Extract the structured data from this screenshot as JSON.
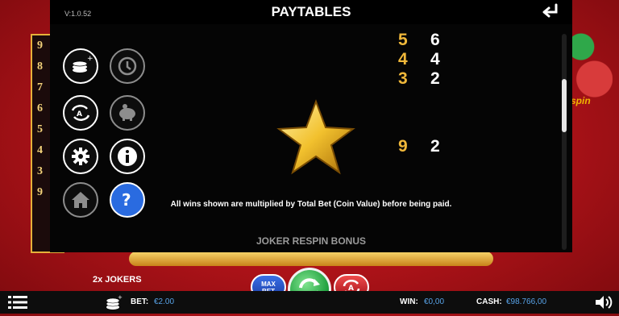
{
  "version": "V:1.0.52",
  "title": "PAYTABLES",
  "background": {
    "reel_numbers": [
      "9",
      "8",
      "7",
      "6",
      "5",
      "4",
      "3",
      "9"
    ],
    "mascot_text": "spin"
  },
  "menu_buttons": [
    {
      "name": "coin-value-icon",
      "active": false
    },
    {
      "name": "history-icon",
      "active": false
    },
    {
      "name": "autoplay-icon",
      "active": false
    },
    {
      "name": "piggy-bank-icon",
      "active": false
    },
    {
      "name": "settings-gear-icon",
      "active": false
    },
    {
      "name": "info-icon",
      "active": false
    },
    {
      "name": "home-icon",
      "active": false
    },
    {
      "name": "help-icon",
      "active": true
    }
  ],
  "paytable": {
    "top_rows": [
      {
        "count": "5",
        "payout": "6"
      },
      {
        "count": "4",
        "payout": "4"
      },
      {
        "count": "3",
        "payout": "2"
      }
    ],
    "star_rows": [
      {
        "count": "9",
        "payout": "2"
      }
    ],
    "info_text": "All wins shown are multiplied by Total Bet (Coin Value) before being paid.",
    "next_section": "JOKER RESPIN BONUS"
  },
  "bottom": {
    "jokers": "2x JOKERS",
    "bet_label": "BET:",
    "bet_value": "€2.00",
    "maxbet_line1": "MAX",
    "maxbet_line2": "BET",
    "win_label": "WIN:",
    "win_value": "€0,00",
    "cash_label": "CASH:",
    "cash_value": "€98.766,00"
  },
  "colors": {
    "accent_gold": "#f0b83a",
    "value_blue": "#58a3e8",
    "active_button": "#2a6be0",
    "spin_green": "#1a9c39",
    "background_red": "#b5141a"
  }
}
